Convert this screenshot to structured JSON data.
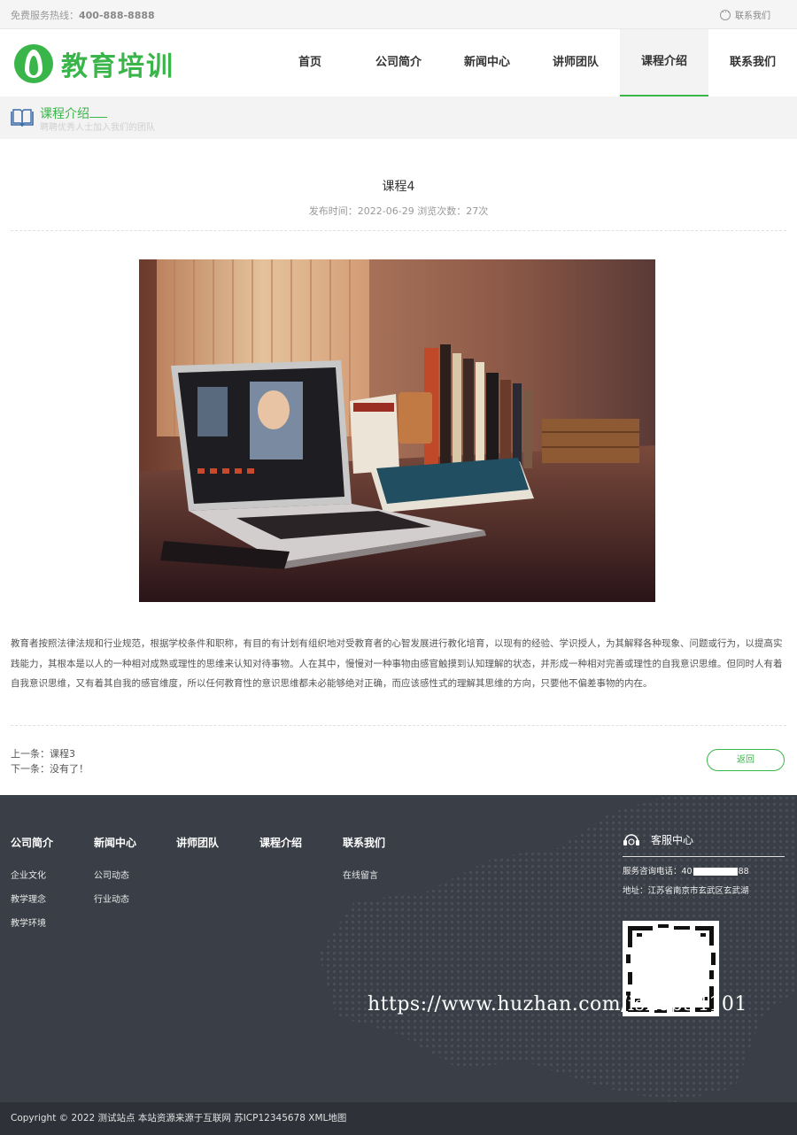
{
  "topbar": {
    "hotline_label": "免费服务热线：",
    "hotline_number": "400-888-8888",
    "contact_label": "联系我们"
  },
  "header": {
    "logo_text": "教育培训",
    "nav": [
      {
        "label": "首页"
      },
      {
        "label": "公司简介"
      },
      {
        "label": "新闻中心"
      },
      {
        "label": "讲师团队"
      },
      {
        "label": "课程介绍"
      },
      {
        "label": "联系我们"
      }
    ],
    "active_index": 4
  },
  "section": {
    "title": "课程介绍",
    "subtitle": "聘聘优秀人士加入我们的团队"
  },
  "article": {
    "title": "课程4",
    "meta": "发布时间：2022-06-29 浏览次数：27次",
    "body": "教育者按照法律法规和行业规范，根据学校条件和职称，有目的有计划有组织地对受教育者的心智发展进行教化培育，以现有的经验、学识授人，为其解释各种现象、问题或行为，以提高实践能力，其根本是以人的一种相对成熟或理性的思维来认知对待事物。人在其中，慢慢对一种事物由感官触摸到认知理解的状态，并形成一种相对完善或理性的自我意识思维。但同时人有着自我意识思维，又有着其自我的感官维度，所以任何教育性的意识思维都未必能够绝对正确，而应该感性式的理解其思维的方向，只要他不偏差事物的内在。",
    "prev": "上一条：课程3",
    "next": "下一条：没有了！",
    "back_label": "返回"
  },
  "footer": {
    "columns": [
      {
        "title": "公司简介",
        "links": [
          "企业文化",
          "教学理念",
          "教学环境"
        ]
      },
      {
        "title": "新闻中心",
        "links": [
          "公司动态",
          "行业动态"
        ]
      },
      {
        "title": "讲师团队",
        "links": []
      },
      {
        "title": "课程介绍",
        "links": []
      },
      {
        "title": "联系我们",
        "links": [
          "在线留言"
        ]
      }
    ],
    "service": {
      "title": "客服中心",
      "phone_prefix": "服务咨询电话：40",
      "phone_suffix": "88",
      "address": "地址：江苏省南京市玄武区玄武湖"
    },
    "watermark": "https://www.huzhan.com/ishop34101",
    "copyright": "Copyright © 2022 测试站点 本站资源来源于互联网 苏ICP12345678 XML地图"
  },
  "colors": {
    "brand_green": "#3ab54a",
    "footer_bg": "#3a3f47",
    "copyright_bg": "#2e3238"
  },
  "icons": [
    "chat-icon",
    "logo-flame-icon",
    "book-icon",
    "headset-icon",
    "qr-code"
  ]
}
